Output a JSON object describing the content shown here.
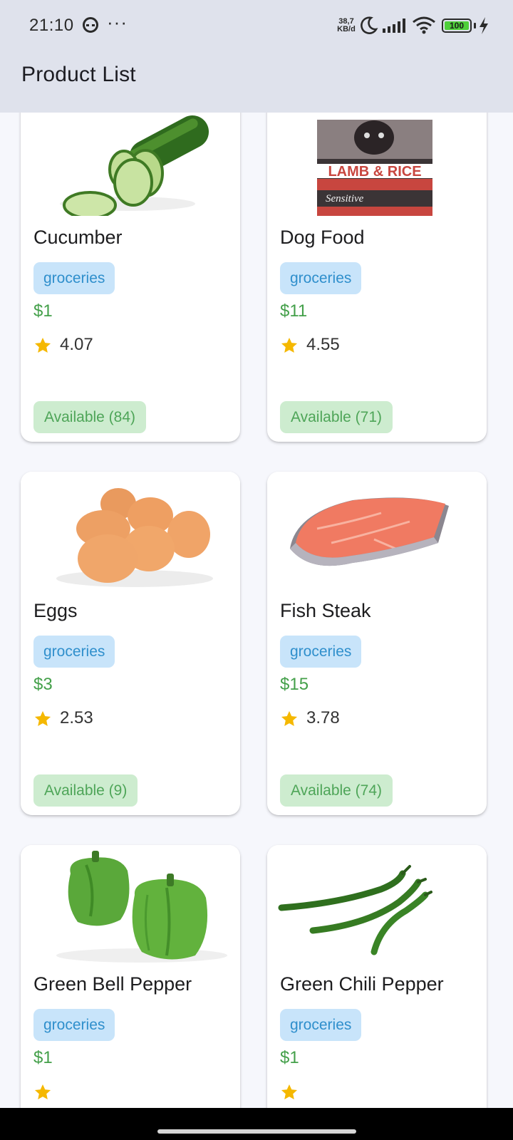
{
  "status_bar": {
    "time": "21:10",
    "more": "···",
    "net_speed_value": "38,7",
    "net_speed_unit": "KB/d",
    "battery_level": "100"
  },
  "app_bar": {
    "title": "Product List"
  },
  "products": [
    {
      "name": "Cucumber",
      "category": "groceries",
      "price": "$1",
      "rating": "4.07",
      "availability": "Available (84)"
    },
    {
      "name": "Dog Food",
      "category": "groceries",
      "price": "$11",
      "rating": "4.55",
      "availability": "Available (71)"
    },
    {
      "name": "Eggs",
      "category": "groceries",
      "price": "$3",
      "rating": "2.53",
      "availability": "Available (9)"
    },
    {
      "name": "Fish Steak",
      "category": "groceries",
      "price": "$15",
      "rating": "3.78",
      "availability": "Available (74)"
    },
    {
      "name": "Green Bell Pepper",
      "category": "groceries",
      "price": "$1",
      "rating": "",
      "availability": ""
    },
    {
      "name": "Green Chili Pepper",
      "category": "groceries",
      "price": "$1",
      "rating": "",
      "availability": ""
    }
  ],
  "colors": {
    "app_bar_bg": "#dfe2ec",
    "page_bg": "#f6f7fc",
    "category_chip_bg": "#c8e4fa",
    "category_chip_text": "#2f8fcc",
    "price_text": "#44a04a",
    "available_chip_bg": "#cdeccf",
    "available_chip_text": "#4ea558",
    "star": "#f5b800"
  },
  "icons": {
    "status_face": "face-icon",
    "moon": "moon-icon",
    "signal": "signal-icon",
    "wifi": "wifi-icon",
    "battery": "battery-icon",
    "charging": "bolt-icon",
    "rating": "star-icon"
  }
}
